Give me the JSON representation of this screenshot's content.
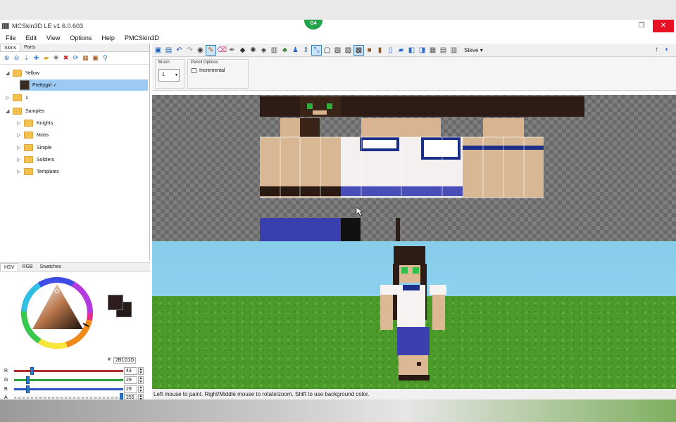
{
  "window": {
    "title": "MCSkin3D LE v1.6.0.603",
    "minimize_icon": "minimize-icon",
    "restore_icon": "restore-icon",
    "close_icon": "close-icon"
  },
  "camera_badge": "G4",
  "menus": [
    "File",
    "Edit",
    "View",
    "Options",
    "Help",
    "PMCSkin3D"
  ],
  "toolbar": {
    "view_label": "Steve",
    "view_arrow": "▾",
    "icons": [
      "save-icon",
      "save-all-icon",
      "undo-icon",
      "redo-icon",
      "camera-icon",
      "pencil-icon",
      "eraser-icon",
      "dropper-icon",
      "fill-icon",
      "noise-icon",
      "darken-icon",
      "stamp-icon",
      "bucket-icon",
      "move-icon",
      "person-icon",
      "select-icon",
      "tool-icon",
      "3d-view-icon",
      "2d-view-icon",
      "split-view-icon",
      "head-part-icon",
      "body-part-icon",
      "arm-part-icon",
      "leg-part-icon",
      "overlay-icon",
      "toggle-overlay-icon",
      "grid-icon",
      "transparent-icon",
      "help-icon"
    ]
  },
  "skins_panel": {
    "tabs": [
      "Skins",
      "Parts"
    ],
    "tree": [
      {
        "label": "Yellow",
        "level": 0,
        "expanded": true
      },
      {
        "label": "Prettygirl ✓",
        "level": 1,
        "selected": true
      },
      {
        "label": "1",
        "level": 0,
        "expanded": false
      },
      {
        "label": "Samples",
        "level": 0,
        "expanded": true
      },
      {
        "label": "Knights",
        "level": 1
      },
      {
        "label": "Mobs",
        "level": 1
      },
      {
        "label": "Simple",
        "level": 1
      },
      {
        "label": "Soldiers",
        "level": 1
      },
      {
        "label": "Templates",
        "level": 1
      }
    ]
  },
  "draw_options": {
    "brush_label": "Brush",
    "brush_value": "1",
    "pencil_group_label": "Pencil Options",
    "incremental_label": "Incremental"
  },
  "color_panel": {
    "tabs": [
      "HSV",
      "RGB",
      "Swatches"
    ],
    "hex_prefix": "#",
    "hex_value": "2B1D1D",
    "primary_color": "#2b1d1d",
    "secondary_color": "#241a18",
    "sliders": [
      {
        "label": "R",
        "value": "43",
        "fill_fraction": 0.17,
        "track_color": "#b33030"
      },
      {
        "label": "G",
        "value": "29",
        "fill_fraction": 0.11,
        "track_color": "#2fa040"
      },
      {
        "label": "B",
        "value": "29",
        "fill_fraction": 0.11,
        "track_color": "#2a55c0"
      },
      {
        "label": "A",
        "value": "255",
        "fill_fraction": 1.0,
        "track_color": "#cfcfcf"
      }
    ]
  },
  "status_text": "Left mouse to paint. Right/Middle mouse to rotate/zoom. Shift to use background color."
}
